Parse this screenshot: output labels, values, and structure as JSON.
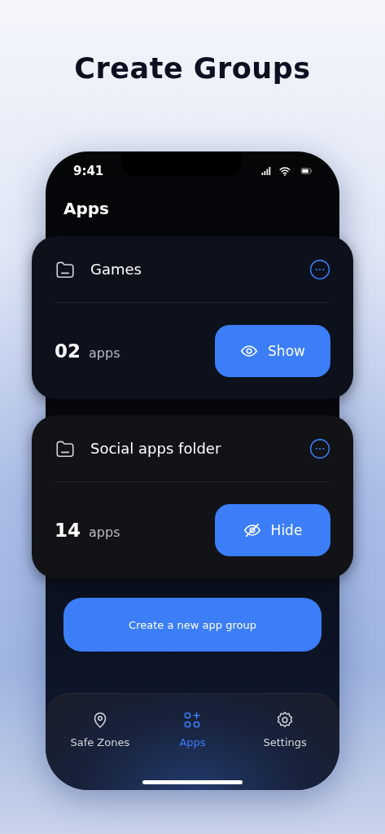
{
  "headline": "Create Groups",
  "status_bar": {
    "time": "9:41"
  },
  "screen_title": "Apps",
  "groups": [
    {
      "name": "Games",
      "count": "02",
      "unit": "apps",
      "action": "Show",
      "hidden": false
    },
    {
      "name": "Social apps folder",
      "count": "14",
      "unit": "apps",
      "action": "Hide",
      "hidden": true
    }
  ],
  "create_button": "Create a new app group",
  "tabs": [
    {
      "label": "Safe Zones",
      "kind": "location",
      "selected": false
    },
    {
      "label": "Apps",
      "kind": "apps",
      "selected": true
    },
    {
      "label": "Settings",
      "kind": "settings",
      "selected": false
    }
  ]
}
